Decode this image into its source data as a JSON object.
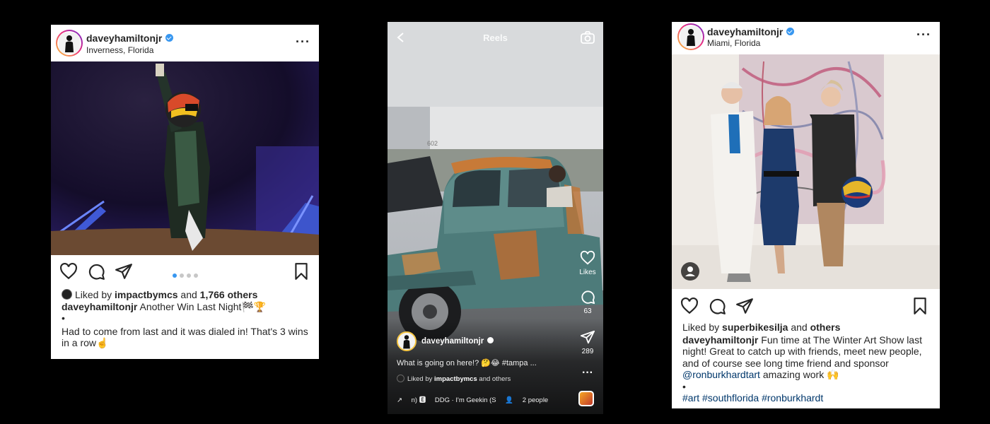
{
  "post_left": {
    "username": "daveyhamiltonjr",
    "location": "Inverness, Florida",
    "liked_by_prefix": "Liked by ",
    "liked_by_user": "impactbymcs",
    "liked_by_mid": " and ",
    "liked_by_count": "1,766 others",
    "caption_user": "daveyhamiltonjr",
    "caption_line1": " Another Win Last Night🏁🏆",
    "caption_bullet": "•",
    "caption_body": "Had to come from last and it was dialed in! That's 3 wins in a row☝️"
  },
  "reel": {
    "title": "Reels",
    "username": "daveyhamiltonjr",
    "likes_label": "Likes",
    "comments_count": "63",
    "shares_count": "289",
    "caption": "What is going on here!? 🤔😂 #tampa ...",
    "liked_by_prefix": "Liked by ",
    "liked_by_user": "impactbymcs",
    "liked_by_suffix": " and others",
    "audio_fragment": "n) 🅴",
    "audio_track": "DDG · I'm Geekin (S",
    "audio_people": "2 people",
    "building_number": "602"
  },
  "post_right": {
    "username": "daveyhamiltonjr",
    "location": "Miami, Florida",
    "liked_by_prefix": "Liked by ",
    "liked_by_user": "superbikesilja",
    "liked_by_mid": " and ",
    "liked_by_others": "others",
    "caption_user": "daveyhamiltonjr",
    "caption_text": " Fun time at The Winter Art Show last night! Great to catch up with friends, meet new people, and of course see long time friend and sponsor ",
    "mention": "@ronburkhardtart",
    "caption_after": " amazing work 🙌",
    "bullet": "•",
    "hashtags": "#art #southflorida #ronburkhardt"
  },
  "icons": {
    "like": "heart-icon",
    "comment": "comment-icon",
    "share": "paper-plane-icon",
    "save": "bookmark-icon",
    "more": "more-options-icon",
    "camera": "camera-icon",
    "back": "back-chevron-icon"
  },
  "colors": {
    "verified": "#3897f0",
    "text": "#262626",
    "link": "#00376b",
    "background": "#000000"
  },
  "carousel": {
    "total": 4,
    "active": 1
  }
}
